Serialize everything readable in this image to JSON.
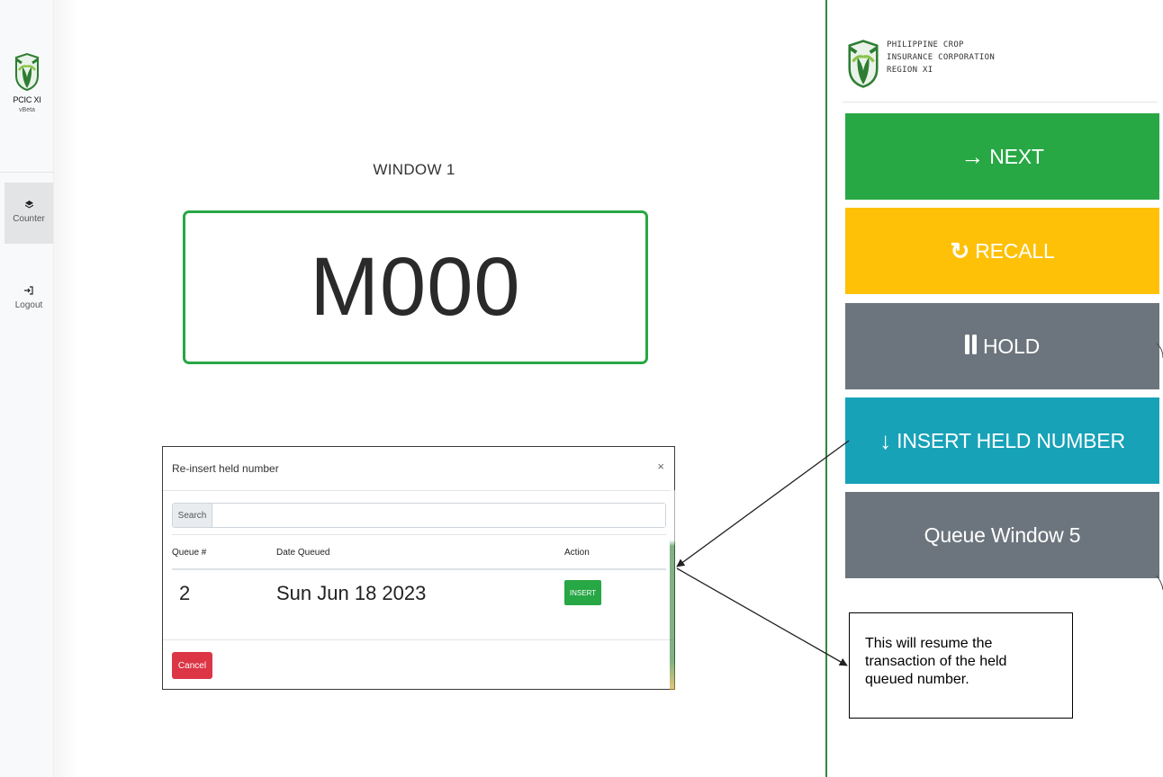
{
  "sidebar": {
    "brand_name": "PCIC XI",
    "version": "vBeta",
    "items": [
      {
        "label": "Counter",
        "icon": "layers-icon"
      },
      {
        "label": "Logout",
        "icon": "sign-in-icon"
      }
    ]
  },
  "main": {
    "window_label": "WINDOW 1",
    "current_number": "M000"
  },
  "modal": {
    "title": "Re-insert held number",
    "close": "×",
    "search_label": "Search",
    "search_placeholder": "",
    "columns": [
      "Queue #",
      "Date Queued",
      "Action"
    ],
    "rows": [
      {
        "queue": "2",
        "date": "Sun Jun 18 2023",
        "action": "INSERT"
      }
    ],
    "cancel_label": "Cancel"
  },
  "panel": {
    "org_lines": [
      "PHILIPPINE CROP",
      "INSURANCE CORPORATION",
      "REGION XI"
    ],
    "buttons": {
      "next": "NEXT",
      "recall": "RECALL",
      "hold": "HOLD",
      "insert": "INSERT HELD NUMBER",
      "queue_window": "Queue Window 5"
    }
  },
  "callout": {
    "text": "This will resume the transaction of the held queued number."
  },
  "colors": {
    "green": "#28a745",
    "yellow": "#ffc107",
    "gray": "#6c757d",
    "teal": "#17a2b8",
    "red": "#dc3545"
  }
}
